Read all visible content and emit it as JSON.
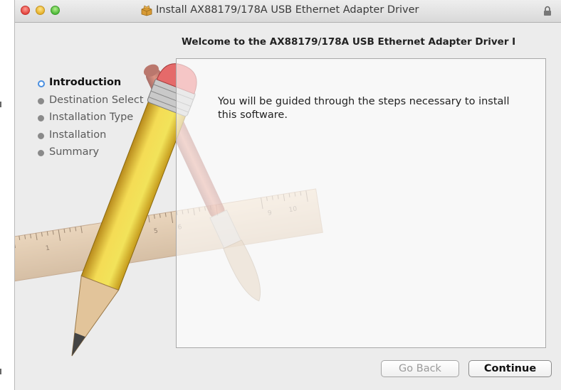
{
  "window": {
    "title": "Install AX88179/178A USB Ethernet Adapter Driver",
    "heading": "Welcome to the AX88179/178A USB Ethernet Adapter Driver I"
  },
  "steps": [
    {
      "label": "Introduction",
      "active": true
    },
    {
      "label": "Destination Select",
      "active": false
    },
    {
      "label": "Installation Type",
      "active": false
    },
    {
      "label": "Installation",
      "active": false
    },
    {
      "label": "Summary",
      "active": false
    }
  ],
  "content": {
    "text": "You will be guided through the steps necessary to install this software."
  },
  "buttons": {
    "go_back": "Go Back",
    "continue": "Continue"
  },
  "ruler": {
    "numbers": [
      "0",
      "1",
      "4",
      "5",
      "6",
      "9",
      "10"
    ]
  },
  "icons": [
    "close-icon",
    "minimize-icon",
    "zoom-icon",
    "package-icon",
    "lock-icon"
  ],
  "colors": {
    "accent": "#4a8fe0",
    "close": "#e2463f",
    "minimize": "#e6b12b",
    "zoom": "#4fb93a"
  }
}
